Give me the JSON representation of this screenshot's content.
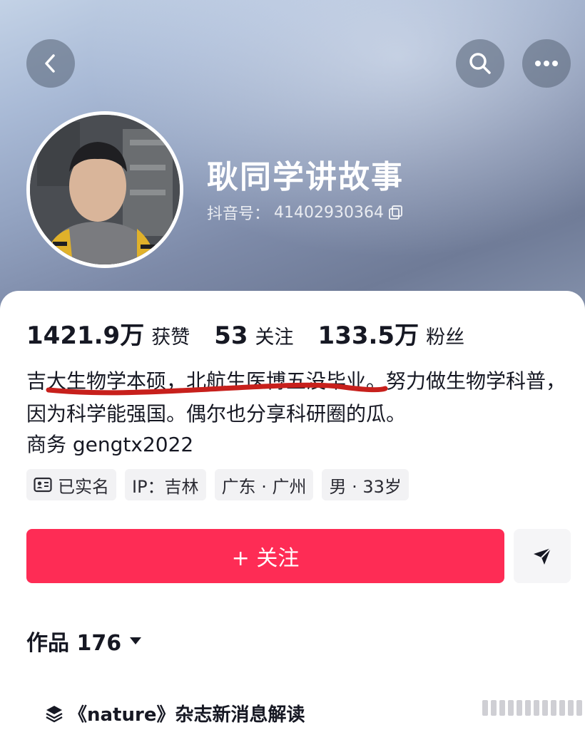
{
  "header": {
    "back_icon": "chevron-left-icon",
    "search_icon": "search-icon",
    "more_icon": "more-dots-icon"
  },
  "profile": {
    "nickname": "耿同学讲故事",
    "douyin_id_label": "抖音号：",
    "douyin_id": "41402930364",
    "copy_icon": "copy-icon"
  },
  "stats": [
    {
      "value": "1421.9万",
      "label": "获赞"
    },
    {
      "value": "53",
      "label": "关注"
    },
    {
      "value": "133.5万",
      "label": "粉丝"
    }
  ],
  "bio": {
    "text": "吉大生物学本硕，北航生医博五没毕业。努力做生物学科普，因为科学能强国。偶尔也分享科研圈的瓜。",
    "business": "商务 gengtx2022"
  },
  "tags": [
    {
      "label": "已实名",
      "icon": "id-card-icon"
    },
    {
      "label": "IP：吉林"
    },
    {
      "label": "广东 · 广州"
    },
    {
      "label": "男 · 33岁"
    }
  ],
  "actions": {
    "follow_label": "+ 关注",
    "share_icon": "send-icon"
  },
  "works": {
    "label": "作品 176",
    "dropdown_icon": "caret-down-icon"
  },
  "collection": {
    "label": "《nature》杂志新消息解读",
    "icon": "layers-icon"
  },
  "colors": {
    "accent": "#fe2c55",
    "annotation_underline": "#c7201c"
  }
}
